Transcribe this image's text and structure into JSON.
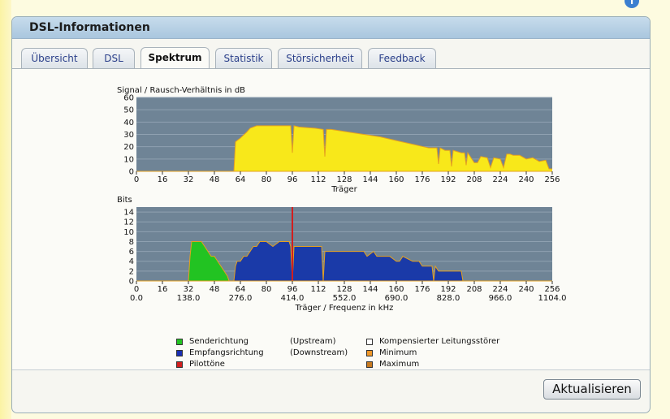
{
  "panel": {
    "title": "DSL-Informationen"
  },
  "tabs": [
    {
      "label": "Übersicht"
    },
    {
      "label": "DSL"
    },
    {
      "label": "Spektrum",
      "active": true
    },
    {
      "label": "Statistik"
    },
    {
      "label": "Störsicherheit"
    },
    {
      "label": "Feedback"
    }
  ],
  "icons": {
    "help": "help-icon",
    "help_glyph": "i"
  },
  "actions": {
    "refresh_label": "Aktualisieren"
  },
  "legend": {
    "upstream": {
      "label": "Senderichtung",
      "hint": "(Upstream)",
      "color": "#22c322"
    },
    "downstream": {
      "label": "Empfangsrichtung",
      "hint": "(Downstream)",
      "color": "#1a2fb4"
    },
    "pilot": {
      "label": "Pilottöne",
      "color": "#d21e1e"
    },
    "noise": {
      "label": "Kompensierter Leitungsstörer",
      "color": "#ffffff"
    },
    "minimum": {
      "label": "Minimum",
      "color": "#f0982a"
    },
    "maximum": {
      "label": "Maximum",
      "color": "#c87a20"
    }
  },
  "chart_data": [
    {
      "type": "area",
      "ylabel": "Signal / Rausch-Verhältnis in dB",
      "xlabel": "Träger",
      "xlim": [
        0,
        256
      ],
      "ylim": [
        0,
        60
      ],
      "yticks": [
        0,
        10,
        20,
        30,
        40,
        50,
        60
      ],
      "xticks": [
        0,
        16,
        32,
        48,
        64,
        80,
        96,
        112,
        128,
        144,
        160,
        176,
        192,
        208,
        224,
        240,
        256
      ],
      "fill_color": "#f8e81a",
      "stroke_color": "#e4a020",
      "x": [
        0,
        60,
        61,
        64,
        68,
        70,
        74,
        80,
        84,
        90,
        94,
        95,
        96,
        97,
        100,
        110,
        115,
        116,
        117,
        120,
        130,
        140,
        150,
        160,
        170,
        180,
        185,
        186,
        187,
        190,
        193,
        194,
        195,
        200,
        202,
        203,
        204,
        208,
        210,
        212,
        216,
        218,
        220,
        224,
        226,
        228,
        230,
        232,
        236,
        240,
        244,
        248,
        252,
        254,
        256
      ],
      "values": [
        0,
        0,
        24,
        27,
        32,
        35,
        37,
        37,
        37,
        37,
        37,
        37,
        15,
        37,
        36,
        35,
        34,
        12,
        34,
        34,
        32,
        30,
        28,
        25,
        22,
        19,
        19,
        6,
        19,
        17,
        17,
        4,
        17,
        15,
        15,
        5,
        15,
        7,
        7,
        12,
        11,
        3,
        11,
        10,
        3,
        14,
        14,
        13,
        13,
        10,
        11,
        8,
        9,
        2,
        2
      ]
    },
    {
      "type": "area",
      "ylabel": "Bits",
      "xlabel": "Träger / Frequenz in kHz",
      "xlim": [
        0,
        256
      ],
      "ylim": [
        0,
        15
      ],
      "yticks": [
        0,
        2,
        4,
        6,
        8,
        10,
        12,
        14
      ],
      "xticks": [
        0,
        16,
        32,
        48,
        64,
        80,
        96,
        112,
        128,
        144,
        160,
        176,
        192,
        208,
        224,
        240,
        256
      ],
      "freq_labels": [
        "0.0",
        "138.0",
        "276.0",
        "414.0",
        "552.0",
        "690.0",
        "828.0",
        "966.0",
        "1104.0"
      ],
      "pilot_carrier": 96,
      "series": [
        {
          "name": "Senderichtung",
          "color": "#22c322",
          "stroke": "#e4a020",
          "x": [
            32,
            33,
            34,
            35,
            40,
            42,
            44,
            46,
            48,
            50,
            52,
            54,
            56,
            57
          ],
          "values": [
            0,
            5,
            8,
            8,
            8,
            7,
            6,
            5,
            5,
            4,
            3,
            2,
            1,
            0
          ]
        },
        {
          "name": "Empfangsrichtung",
          "color": "#1a3aa8",
          "stroke": "#e4a020",
          "x": [
            60,
            61,
            62,
            64,
            66,
            68,
            70,
            72,
            74,
            76,
            78,
            80,
            84,
            88,
            90,
            92,
            94,
            95,
            96,
            97,
            98,
            100,
            110,
            114,
            115,
            116,
            118,
            120,
            130,
            140,
            142,
            146,
            148,
            150,
            156,
            160,
            162,
            164,
            170,
            172,
            174,
            176,
            180,
            182,
            183,
            184,
            186,
            188,
            190,
            192,
            194,
            196,
            200,
            201
          ],
          "values": [
            0,
            3,
            4,
            4,
            5,
            5,
            6,
            7,
            7,
            8,
            8,
            8,
            7,
            8,
            8,
            8,
            8,
            7,
            0,
            7,
            7,
            7,
            7,
            7,
            0,
            6,
            6,
            6,
            6,
            6,
            5,
            6,
            5,
            5,
            5,
            4,
            4,
            5,
            4,
            4,
            4,
            3,
            3,
            3,
            0,
            3,
            2,
            2,
            2,
            2,
            2,
            2,
            2,
            0
          ]
        }
      ]
    }
  ]
}
